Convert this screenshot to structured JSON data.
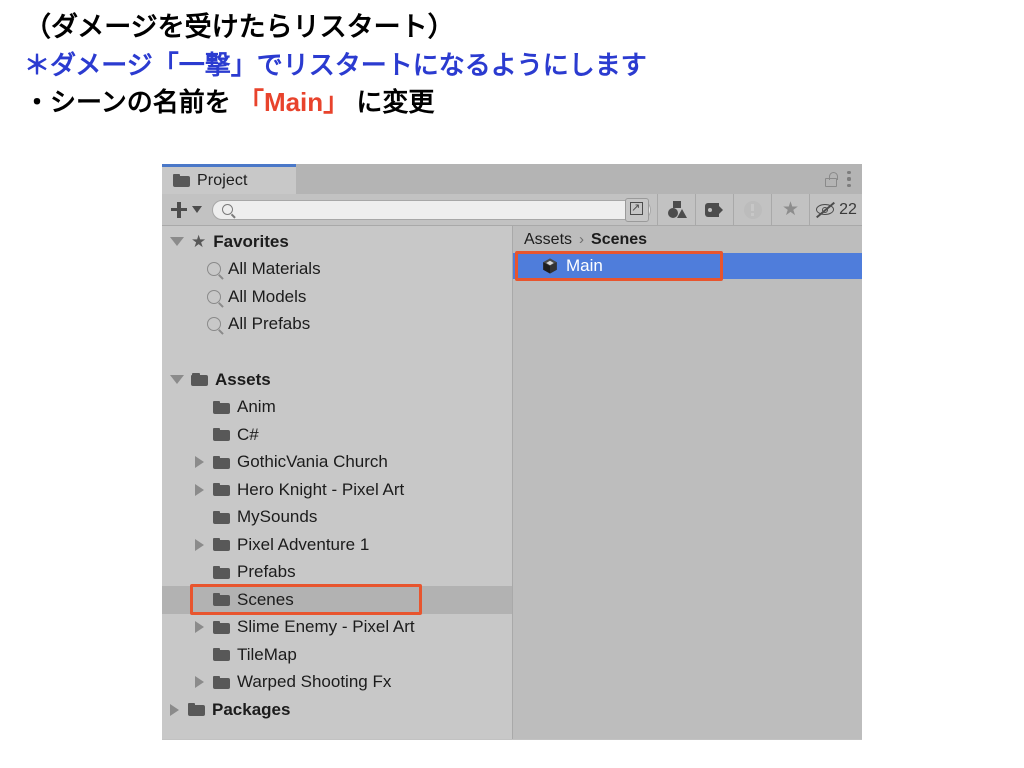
{
  "slide": {
    "line1": "（ダメージを受けたらリスタート）",
    "line2": "＊ダメージ「一撃」でリスタートになるようにします",
    "line3_prefix": "・シーンの名前を ",
    "line3_accent": "「Main」",
    "line3_suffix": " に変更",
    "colors": {
      "blue": "#2b3bd0",
      "red": "#e8432c",
      "black": "#000000"
    }
  },
  "window": {
    "tab": {
      "label": "Project",
      "icon": "folder-icon",
      "lock_icon": "lock-open-icon",
      "menu_icon": "kebab-menu-icon"
    },
    "toolbar": {
      "add_label": "+",
      "add_dropdown_icon": "chevron-down-icon",
      "search": {
        "value": "",
        "placeholder": "",
        "icon": "search-icon"
      },
      "subwindow_icon": "open-in-subwindow-icon",
      "filters": [
        {
          "name": "type-filter-icon",
          "label": ""
        },
        {
          "name": "label-filter-icon",
          "label": ""
        },
        {
          "name": "warning-filter-icon",
          "label": ""
        },
        {
          "name": "favorite-filter-icon",
          "label": ""
        }
      ],
      "hidden_items": {
        "icon": "eye-off-icon",
        "count": "22"
      }
    },
    "tree": {
      "favorites": {
        "label": "Favorites",
        "icon": "star-icon",
        "expanded": true,
        "items": [
          {
            "label": "All Materials",
            "icon": "search-icon"
          },
          {
            "label": "All Models",
            "icon": "search-icon"
          },
          {
            "label": "All Prefabs",
            "icon": "search-icon"
          }
        ]
      },
      "assets": {
        "label": "Assets",
        "icon": "folder-open-icon",
        "expanded": true,
        "items": [
          {
            "label": "Anim",
            "expandable": false,
            "selected": false
          },
          {
            "label": "C#",
            "expandable": false,
            "selected": false
          },
          {
            "label": "GothicVania Church",
            "expandable": true,
            "selected": false
          },
          {
            "label": "Hero Knight - Pixel Art",
            "expandable": true,
            "selected": false
          },
          {
            "label": "MySounds",
            "expandable": false,
            "selected": false
          },
          {
            "label": "Pixel Adventure 1",
            "expandable": true,
            "selected": false
          },
          {
            "label": "Prefabs",
            "expandable": false,
            "selected": false
          },
          {
            "label": "Scenes",
            "expandable": false,
            "selected": true
          },
          {
            "label": "Slime Enemy - Pixel Art",
            "expandable": true,
            "selected": false
          },
          {
            "label": "TileMap",
            "expandable": false,
            "selected": false
          },
          {
            "label": "Warped Shooting Fx",
            "expandable": true,
            "selected": false
          }
        ]
      },
      "packages": {
        "label": "Packages",
        "icon": "folder-icon",
        "expanded": false
      }
    },
    "content": {
      "breadcrumb": {
        "root": "Assets",
        "separator": "›",
        "current": "Scenes"
      },
      "assets": [
        {
          "name": "Main",
          "icon": "unity-scene-icon",
          "selected": true
        }
      ],
      "selection_color": "#4f7ddb"
    },
    "annotations": {
      "highlight_color": "#e8552e",
      "targets": [
        "Scenes",
        "Main"
      ]
    }
  }
}
